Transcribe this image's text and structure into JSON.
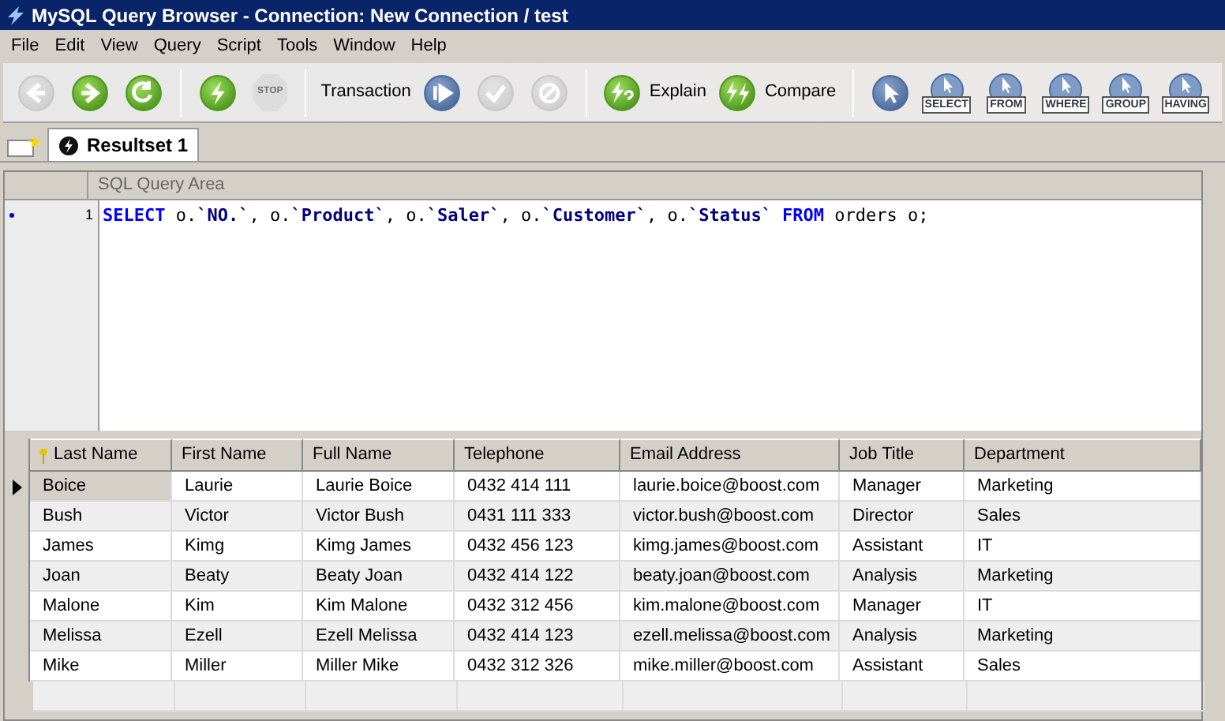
{
  "window": {
    "title": "MySQL Query Browser - Connection: New Connection / test"
  },
  "menu": [
    "File",
    "Edit",
    "View",
    "Query",
    "Script",
    "Tools",
    "Window",
    "Help"
  ],
  "toolbar": [
    {
      "kind": "back",
      "disabled": true
    },
    {
      "kind": "forward",
      "disabled": false
    },
    {
      "kind": "refresh",
      "disabled": false
    },
    {
      "kind": "separator"
    },
    {
      "kind": "execute",
      "disabled": false
    },
    {
      "kind": "stop",
      "label": "STOP",
      "disabled": true
    },
    {
      "kind": "separator"
    },
    {
      "kind": "label",
      "label": "Transaction"
    },
    {
      "kind": "start",
      "disabled": false
    },
    {
      "kind": "commit",
      "disabled": true
    },
    {
      "kind": "rollback",
      "disabled": true
    },
    {
      "kind": "separator"
    },
    {
      "kind": "explain",
      "label": "Explain"
    },
    {
      "kind": "compare",
      "label": "Compare"
    },
    {
      "kind": "separator"
    },
    {
      "kind": "pointer",
      "disabled": false
    },
    {
      "kind": "clause",
      "label": "SELECT"
    },
    {
      "kind": "clause",
      "label": "FROM"
    },
    {
      "kind": "clause",
      "label": "WHERE"
    },
    {
      "kind": "clause",
      "label": "GROUP"
    },
    {
      "kind": "clause",
      "label": "HAVING"
    }
  ],
  "tabs": [
    {
      "label": "Resultset 1",
      "selected": true
    }
  ],
  "query_area": {
    "title": "SQL Query Area",
    "line_number": "1",
    "tokens": [
      {
        "kind": "keyword",
        "text": "SELECT"
      },
      {
        "kind": "plain",
        "text": " o."
      },
      {
        "kind": "ident",
        "text": "`NO.`"
      },
      {
        "kind": "plain",
        "text": ", o."
      },
      {
        "kind": "ident",
        "text": "`Product`"
      },
      {
        "kind": "plain",
        "text": ", o."
      },
      {
        "kind": "ident",
        "text": "`Saler`"
      },
      {
        "kind": "plain",
        "text": ", o."
      },
      {
        "kind": "ident",
        "text": "`Customer`"
      },
      {
        "kind": "plain",
        "text": ", o."
      },
      {
        "kind": "ident",
        "text": "`Status`"
      },
      {
        "kind": "keyword",
        "text": " FROM"
      },
      {
        "kind": "plain",
        "text": " orders o;"
      }
    ]
  },
  "table": {
    "columns": [
      {
        "label": "Last Name",
        "key": true
      },
      {
        "label": "First Name",
        "key": false
      },
      {
        "label": "Full Name",
        "key": false
      },
      {
        "label": "Telephone",
        "key": false
      },
      {
        "label": "Email Address",
        "key": false
      },
      {
        "label": "Job Title",
        "key": false
      },
      {
        "label": "Department",
        "key": false
      }
    ],
    "rows": [
      {
        "selected": true,
        "cells": [
          "Boice",
          "Laurie",
          "Laurie Boice",
          "0432 414 111",
          "laurie.boice@boost.com",
          "Manager",
          "Marketing"
        ]
      },
      {
        "selected": false,
        "cells": [
          "Bush",
          "Victor",
          "Victor Bush",
          "0431 111 333",
          "victor.bush@boost.com",
          "Director",
          "Sales"
        ]
      },
      {
        "selected": false,
        "cells": [
          "James",
          "Kimg",
          "Kimg James",
          "0432 456 123",
          "kimg.james@boost.com",
          "Assistant",
          "IT"
        ]
      },
      {
        "selected": false,
        "cells": [
          "Joan",
          "Beaty",
          "Beaty Joan",
          "0432 414 122",
          "beaty.joan@boost.com",
          "Analysis",
          "Marketing"
        ]
      },
      {
        "selected": false,
        "cells": [
          "Malone",
          "Kim",
          "Kim Malone",
          "0432 312 456",
          "kim.malone@boost.com",
          "Manager",
          "IT"
        ]
      },
      {
        "selected": false,
        "cells": [
          "Melissa",
          "Ezell",
          "Ezell Melissa",
          "0432 414 123",
          "ezell.melissa@boost.com",
          "Analysis",
          "Marketing"
        ]
      },
      {
        "selected": false,
        "cells": [
          "Mike",
          "Miller",
          "Miller Mike",
          "0432 312 326",
          "mike.miller@boost.com",
          "Assistant",
          "Sales"
        ]
      }
    ]
  }
}
